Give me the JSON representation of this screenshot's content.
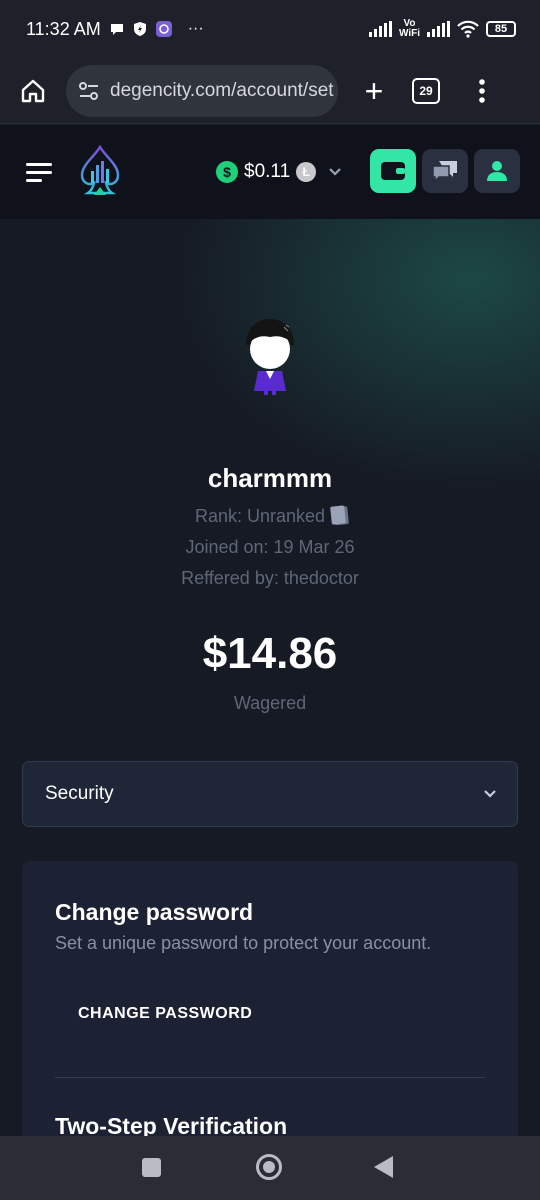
{
  "status_bar": {
    "time": "11:32 AM",
    "dots": "···",
    "vowifi_line1": "Vo",
    "vowifi_line2": "WiFi",
    "battery": "85",
    "icons": [
      "chat-bubble-icon",
      "shield-icon",
      "viber-icon",
      "signal-icon",
      "wifi-icon",
      "battery-icon"
    ]
  },
  "browser": {
    "url": "degencity.com/account/set",
    "tabs_count": "29",
    "plus": "+",
    "menu": "⋮"
  },
  "header": {
    "balance": "$0.11",
    "currency_symbol": "$",
    "crypto_symbol": "Ł",
    "accent_color": "#33e6a5"
  },
  "profile": {
    "username": "charmmm",
    "rank": "Rank: Unranked",
    "joined": "Joined on: 19 Mar 26",
    "referred": "Reffered by: thedoctor",
    "wagered_amount": "$14.86",
    "wagered_label": "Wagered"
  },
  "section_select": {
    "selected": "Security"
  },
  "security_panel": {
    "change_password_title": "Change password",
    "change_password_desc": "Set a unique password to protect your account.",
    "change_password_button": "CHANGE PASSWORD",
    "two_step_title": "Two-Step Verification"
  }
}
